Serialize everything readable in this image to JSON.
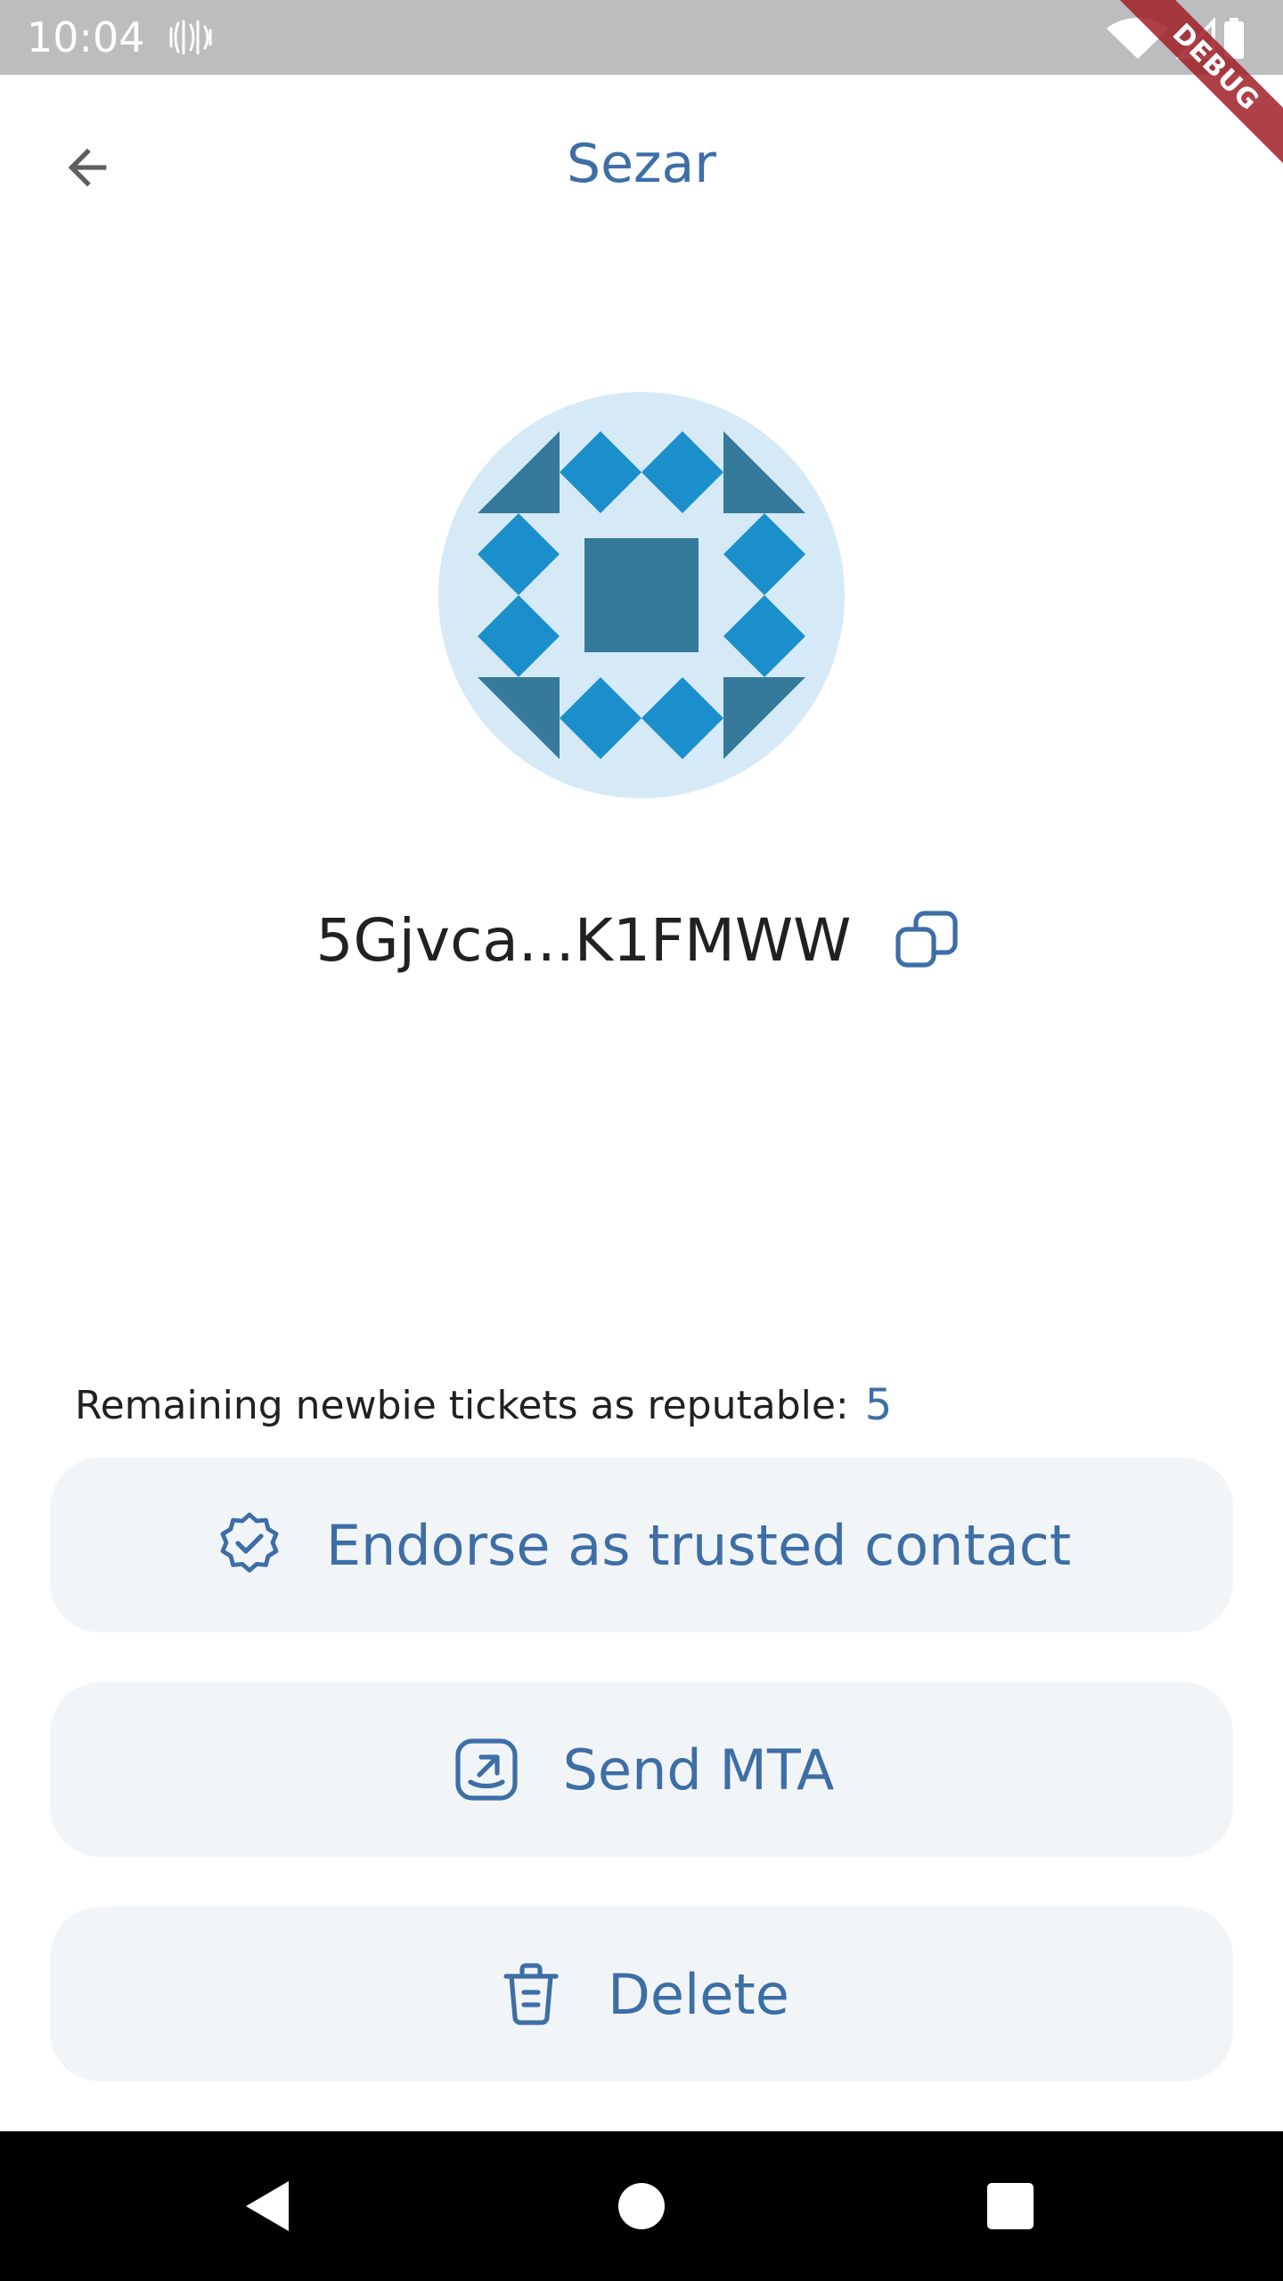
{
  "status_bar": {
    "time": "10:04"
  },
  "debug_banner": {
    "label": "DEBUG"
  },
  "app_bar": {
    "title": "Sezar",
    "back_icon": "arrow-back-icon"
  },
  "contact": {
    "address": "5Gjvca...K1FMWW",
    "copy_icon": "copy-icon",
    "identicon_colors": {
      "background": "#d5eaf6",
      "dark": "#35799b",
      "light": "#1b8fcb"
    }
  },
  "reputation": {
    "tickets_label": "Remaining newbie tickets as reputable:",
    "tickets_count": "5"
  },
  "actions": {
    "endorse": {
      "label": "Endorse as trusted contact",
      "icon": "verified-badge-icon"
    },
    "send": {
      "label": "Send MTA",
      "icon": "send-arrow-icon"
    },
    "delete": {
      "label": "Delete",
      "icon": "trash-icon"
    }
  },
  "colors": {
    "accent": "#3d6ea6",
    "button_background": "#f2f5f8",
    "text": "#212121"
  },
  "navigation": {
    "back": "nav-back-icon",
    "home": "nav-home-icon",
    "recents": "nav-recents-icon"
  }
}
